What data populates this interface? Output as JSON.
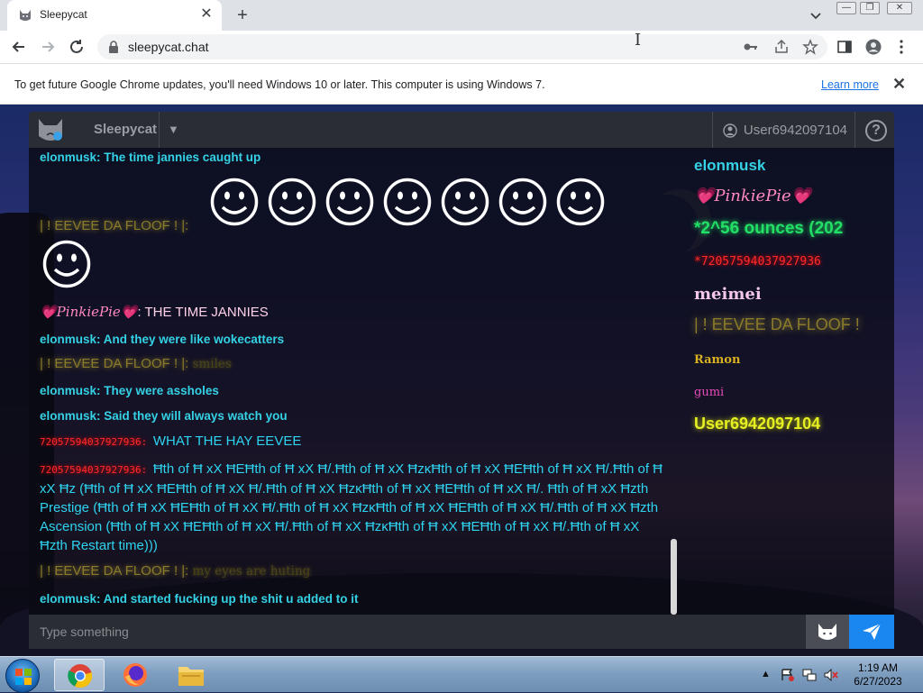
{
  "browser": {
    "tab_title": "Sleepycat",
    "url": "sleepycat.chat",
    "infobar_text": "To get future Google Chrome updates, you'll need Windows 10 or later. This computer is using Windows 7.",
    "infobar_link": "Learn more"
  },
  "app": {
    "name": "Sleepycat",
    "current_user": "User6942097104",
    "help_label": "?",
    "input_placeholder": "Type something"
  },
  "messages": [
    {
      "nick": "elonmusk",
      "sep": ": ",
      "text": "The time jannies caught up"
    },
    {
      "nick": "| ! EEVEE DA FLOOF ! |",
      "sep": ": ",
      "text": ""
    },
    {
      "nick": "💗PinkiePie💗",
      "sep": ": ",
      "text": "THE TIME JANNIES"
    },
    {
      "nick": "elonmusk",
      "sep": ": ",
      "text": "And they were like wokecatters"
    },
    {
      "nick": "| ! EEVEE DA FLOOF ! |",
      "sep": ": ",
      "text": "smiles"
    },
    {
      "nick": "elonmusk",
      "sep": ": ",
      "text": "They were assholes"
    },
    {
      "nick": "elonmusk",
      "sep": ": ",
      "text": "Said they will always watch you"
    },
    {
      "nick": "72057594037927936",
      "sep": ": ",
      "text": "WHAT THE HAY EEVEE"
    },
    {
      "nick": "72057594037927936",
      "sep": ": ",
      "text": "Ħth of Ħ xX ĦEĦth of Ħ xX Ħ/.Ħth of Ħ xX ĦzĸĦth of Ħ xX ĦEĦth of Ħ xX Ħ/.Ħth of Ħ xX Ħz (Ħth of Ħ xX ĦEĦth of Ħ xX Ħ/.Ħth of Ħ xX ĦzĸĦth of Ħ xX ĦEĦth of Ħ xX Ħ/. Ħth of Ħ xX Ħzth Prestige (Ħth of Ħ xX ĦEĦth of Ħ xX Ħ/.Ħth of Ħ xX ĦzĸĦth of Ħ xX ĦEĦth of Ħ xX Ħ/.Ħth of Ħ xX Ħzth Ascension (Ħth of Ħ xX ĦEĦth of Ħ xX Ħ/.Ħth of Ħ xX ĦzĸĦth of Ħ xX ĦEĦth of Ħ xX Ħ/.Ħth of Ħ xX Ħzth Restart time)))"
    },
    {
      "nick": "| ! EEVEE DA FLOOF ! |",
      "sep": ": ",
      "text": "my eyes are huting"
    },
    {
      "nick": "elonmusk",
      "sep": ": ",
      "text": "And started fucking up the shit u added to it"
    }
  ],
  "smileys": {
    "row_count": 7,
    "single_count": 1,
    "glyph": "smiley-face"
  },
  "online_users": [
    {
      "name": "elonmusk",
      "color": "#35d1e4"
    },
    {
      "name": "💗PinkiePie💗",
      "color": "#ff88c0"
    },
    {
      "name": "*2^56 ounces (202",
      "color": "#22e066"
    },
    {
      "name": "*72057594037927936",
      "color": "#ff2a2a"
    },
    {
      "name": "meimei",
      "color": "#f4c6e8"
    },
    {
      "name": "| ! EEVEE DA FLOOF !",
      "color": "#8a7a2a"
    },
    {
      "name": "Ramon",
      "color": "#d8b020"
    },
    {
      "name": "gumi",
      "color": "#e84ab8"
    },
    {
      "name": "User6942097104",
      "color": "#e6ef22"
    }
  ],
  "taskbar": {
    "time": "1:19 AM",
    "date": "6/27/2023"
  }
}
